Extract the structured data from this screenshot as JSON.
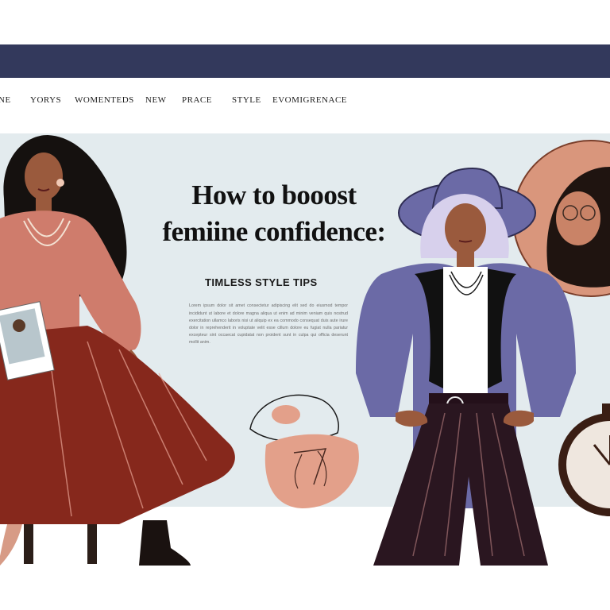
{
  "header": {
    "bar_color": "#33395c"
  },
  "nav": {
    "items": [
      {
        "label": "NE"
      },
      {
        "label": "YORYS"
      },
      {
        "label": "WOMENTEDS"
      },
      {
        "label": "NEW"
      },
      {
        "label": "PRACE"
      },
      {
        "label": "STYLE"
      },
      {
        "label": "EVOMIGRENACE"
      }
    ]
  },
  "article": {
    "headline": "How to booost femiine confidence:",
    "subheading": "TIMLESS STYLE TIPS",
    "body": "Lorem ipsum dolor sit amet consectetur adipiscing elit sed do eiusmod tempor incididunt ut labore et dolore magna aliqua ut enim ad minim veniam quis nostrud exercitation ullamco laboris nisi ut aliquip ex ea commodo consequat duis aute irure dolor in reprehenderit in voluptate velit esse cillum dolore eu fugiat nulla pariatur excepteur sint occaecat cupidatat non proident sunt in culpa qui officia deserunt mollit anim."
  },
  "colors": {
    "hero_background": "#e3ebee",
    "accent_purple": "#6b6aa6",
    "accent_terracotta": "#8c2f22",
    "accent_blush": "#e3a08a"
  }
}
